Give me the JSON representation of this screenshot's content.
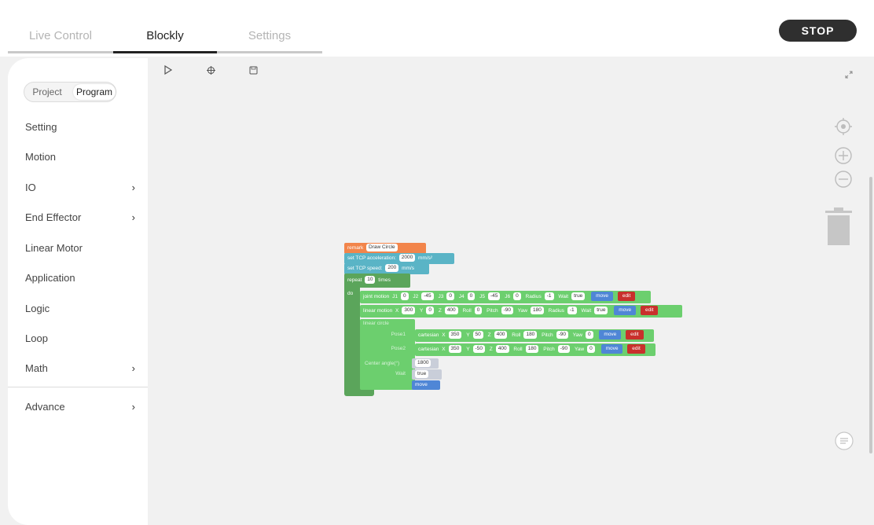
{
  "tabs": {
    "live_control": "Live Control",
    "blockly": "Blockly",
    "settings": "Settings"
  },
  "stop_label": "STOP",
  "segment": {
    "project": "Project",
    "program": "Program"
  },
  "menu": {
    "setting": "Setting",
    "motion": "Motion",
    "io": "IO",
    "end_effector": "End Effector",
    "linear_motor": "Linear Motor",
    "application": "Application",
    "logic": "Logic",
    "loop": "Loop",
    "math": "Math",
    "advance": "Advance"
  },
  "toolbar": {
    "run_icon": "play-icon",
    "debug_icon": "debug-icon",
    "save_icon": "save-icon"
  },
  "right_controls": [
    "expand-icon",
    "recenter-icon",
    "zoom-in-icon",
    "zoom-out-icon",
    "trash-icon",
    "menu-list-icon"
  ],
  "blocks": {
    "remark": {
      "label": "remark",
      "value": "Draw Circle"
    },
    "tcp_acc": {
      "label": "set TCP acceleration:",
      "value": "2000",
      "unit": "mm/s²"
    },
    "tcp_speed": {
      "label": "set TCP speed:",
      "value": "200",
      "unit": "mm/s"
    },
    "repeat": {
      "label": "repeat",
      "value": "10",
      "suffix": "times",
      "do": "do"
    },
    "joint": {
      "label": "joint motion",
      "j1l": "J1",
      "j1": "0",
      "j2l": "J2",
      "j2": "-45",
      "j3l": "J3",
      "j3": "0",
      "j4l": "J4",
      "j4": "0",
      "j5l": "J5",
      "j5": "-45",
      "j6l": "J6",
      "j6": "0",
      "radius_l": "Radius",
      "radius": "-1",
      "wait_l": "Wait",
      "wait": "true",
      "move": "move",
      "edit": "edit"
    },
    "linear": {
      "label": "linear motion",
      "xl": "X",
      "x": "300",
      "yl": "Y",
      "y": "0",
      "zl": "Z",
      "z": "400",
      "rolll": "Roll",
      "roll": "0",
      "pitchl": "Pitch",
      "pitch": "-90",
      "yawl": "Yaw",
      "yaw": "180",
      "radius_l": "Radius",
      "radius": "-1",
      "wait_l": "Wait",
      "wait": "true",
      "move": "move",
      "edit": "edit"
    },
    "circle": {
      "label": "linear circle",
      "pose1": "Pose1",
      "pose2": "Pose2",
      "cart": "cartesian",
      "p1": {
        "x": "350",
        "y": "50",
        "z": "400",
        "roll": "180",
        "pitch": "-90",
        "yaw": "0"
      },
      "p2": {
        "x": "350",
        "y": "-50",
        "z": "400",
        "roll": "180",
        "pitch": "-90",
        "yaw": "0"
      },
      "xl": "X",
      "yl": "Y",
      "zl": "Z",
      "rolll": "Roll",
      "pitchl": "Pitch",
      "yawl": "Yaw",
      "center_l": "Center angle(°)",
      "center": "1800",
      "wait_l": "Wait",
      "wait": "true",
      "move": "move",
      "edit": "edit"
    }
  },
  "colors": {
    "accent": "#2f2f2f",
    "remark": "#f2854b",
    "tcp": "#5ab4c6",
    "loop": "#5ba55b",
    "motion": "#6ccf6e",
    "move": "#4f86d6",
    "edit": "#c9302c"
  }
}
